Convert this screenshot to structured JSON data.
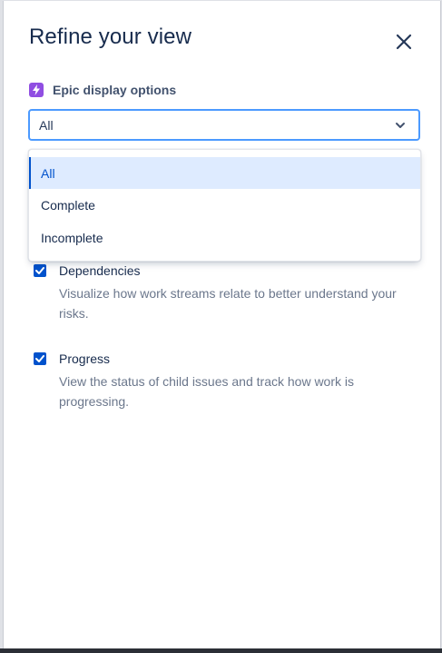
{
  "panel": {
    "title": "Refine your view",
    "close_icon": "close-icon"
  },
  "epic_display": {
    "label": "Epic display options",
    "icon": "lightning-icon",
    "icon_color": "#904ee2",
    "selected_value": "All",
    "options": [
      {
        "label": "All",
        "selected": true
      },
      {
        "label": "Complete",
        "selected": false
      },
      {
        "label": "Incomplete",
        "selected": false
      }
    ]
  },
  "checkboxes": [
    {
      "title": "Dependencies",
      "description": "Visualize how work streams relate to better understand your risks.",
      "checked": true
    },
    {
      "title": "Progress",
      "description": "View the status of child issues and track how work is progressing.",
      "checked": true
    }
  ],
  "colors": {
    "accent": "#0052cc",
    "focus_border": "#4c9aff",
    "selected_bg": "#deebff"
  }
}
